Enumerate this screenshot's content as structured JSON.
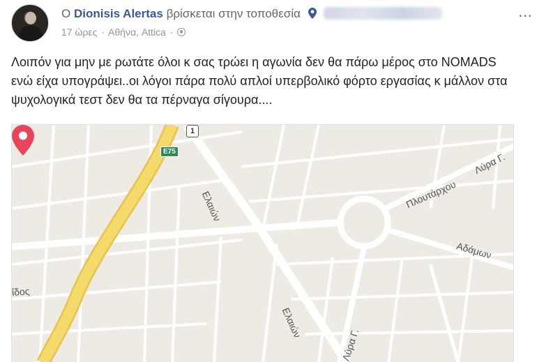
{
  "post": {
    "prefix": "Ο",
    "author": "Dionisis Alertas",
    "action": "βρίσκεται στην τοποθεσία",
    "time": "17 ώρες",
    "separator": "·",
    "location": "Αθήνα, Attica",
    "privacy_icon": "globe-icon",
    "more_icon": "⋯",
    "text": "Λοιπόν για μην με ρωτάτε όλοι κ σας τρώει η αγωνία δεν θα πάρω μέρος στο NOMADS ενώ είχα υπογράψει..οι λόγοι πάρα πολύ απλοί υπερβολικό φόρτο εργασίας κ μάλλον στα ψυχολογικά τεστ δεν θα τα πέρναγα σίγουρα...."
  },
  "map": {
    "labels": {
      "elaion_top": "Ελαιών",
      "elaion_bottom": "Ελαιών",
      "ploutarchou": "Πλουτάρχου",
      "lyra_top": "Λύρα Γ.",
      "adamon": "Αδάμων",
      "idos": "ΐδος",
      "lyra_bottom": "Λύρα Γ."
    },
    "shields": {
      "e75": "E75",
      "route1": "1"
    },
    "colors": {
      "land": "#eeeae4",
      "road": "#ffffff",
      "highway": "#f4d96b",
      "marker": "#e8445a"
    }
  }
}
